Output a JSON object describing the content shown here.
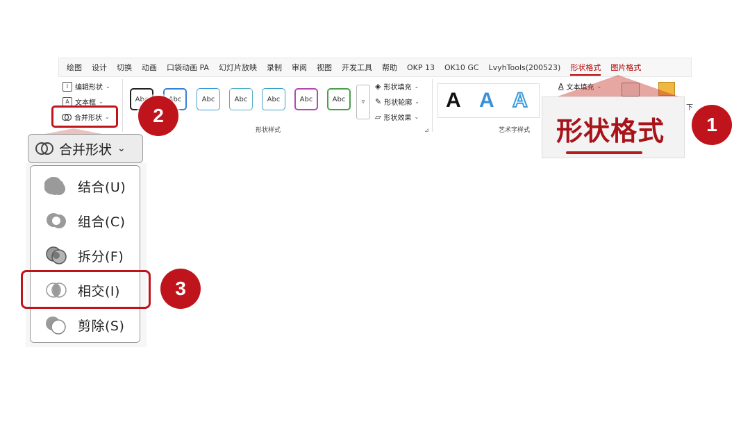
{
  "ribbon": {
    "tabs": [
      "绘图",
      "设计",
      "切换",
      "动画",
      "口袋动画 PA",
      "幻灯片放映",
      "录制",
      "审阅",
      "视图",
      "开发工具",
      "帮助",
      "OKP 13",
      "OK10 GC",
      "LvyhTools(200523)",
      "形状格式",
      "图片格式"
    ],
    "active_tab": "形状格式",
    "left_commands": {
      "edit_shape": "编辑形状",
      "text_box": "文本框",
      "merge_shapes": "合并形状"
    },
    "shape_styles": {
      "sample_text": "Abc",
      "colors": [
        "#222222",
        "#3a7fd5",
        "#3a9ad9",
        "#4fb0c6",
        "#3aa0c8",
        "#b04ab0",
        "#4aa04a"
      ],
      "group_label": "形状样式"
    },
    "shape_commands": {
      "fill": "形状填充",
      "outline": "形状轮廓",
      "effects": "形状效果"
    },
    "wordart": {
      "letter": "A",
      "group_label": "艺术字样式",
      "text_fill": "文本填充",
      "partial_down": "下"
    }
  },
  "callout1": {
    "title": "形状格式",
    "badge": "1"
  },
  "badge2": "2",
  "badge3": "3",
  "merge_menu": {
    "header": "合并形状",
    "items": [
      {
        "label": "结合(U)",
        "icon": "union-icon"
      },
      {
        "label": "组合(C)",
        "icon": "combine-icon"
      },
      {
        "label": "拆分(F)",
        "icon": "fragment-icon"
      },
      {
        "label": "相交(I)",
        "icon": "intersect-icon"
      },
      {
        "label": "剪除(S)",
        "icon": "subtract-icon"
      }
    ],
    "selected": "相交(I)"
  },
  "accent_color": "#c0141c"
}
